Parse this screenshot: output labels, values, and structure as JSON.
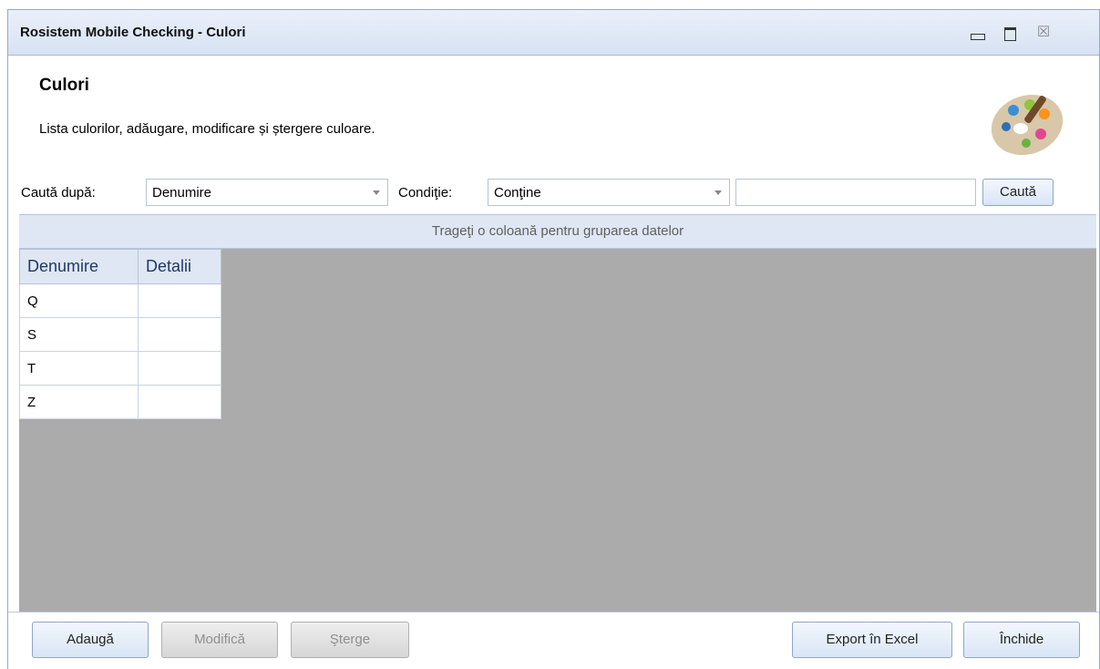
{
  "window": {
    "title": "Rosistem Mobile Checking - Culori",
    "close_glyph": "☒"
  },
  "header": {
    "title": "Culori",
    "description": "Lista culorilor, adăugare, modificare și ștergere culoare.",
    "icon": "palette-icon"
  },
  "search": {
    "search_by_label": "Caută după:",
    "search_by_value": "Denumire",
    "condition_label": "Condiţie:",
    "condition_value": "Conţine",
    "query_value": "",
    "search_button": "Caută"
  },
  "group_panel": {
    "text": "Trageţi o coloană pentru gruparea datelor"
  },
  "grid": {
    "columns": [
      "Denumire",
      "Detalii"
    ],
    "rows": [
      [
        "Q",
        ""
      ],
      [
        "S",
        ""
      ],
      [
        "T",
        ""
      ],
      [
        "Z",
        ""
      ]
    ]
  },
  "footer": {
    "add": "Adaugă",
    "modify": "Modifică",
    "delete": "Şterge",
    "export": "Export în Excel",
    "close": "Închide"
  },
  "colors": {
    "titlebar": "#d7e2f3",
    "group_panel": "#dfe7f4",
    "grid_background": "#ababab"
  }
}
